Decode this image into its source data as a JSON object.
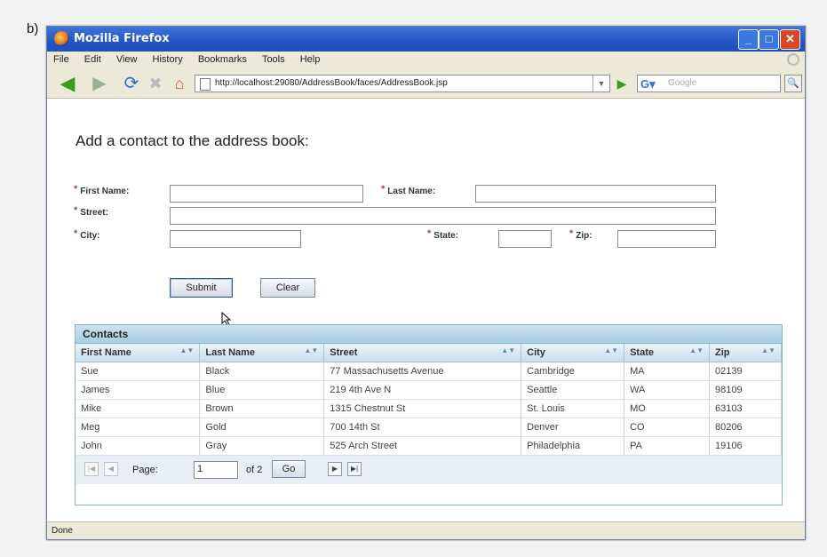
{
  "figure_label": "b)",
  "window": {
    "title": "Mozilla Firefox"
  },
  "menu": [
    "File",
    "Edit",
    "View",
    "History",
    "Bookmarks",
    "Tools",
    "Help"
  ],
  "address": {
    "url": "http://localhost:29080/AddressBook/faces/AddressBook.jsp"
  },
  "search": {
    "placeholder": "Google"
  },
  "page": {
    "heading": "Add a contact to the address book:",
    "required_mark": "*",
    "labels": {
      "first_name": "First Name:",
      "last_name": "Last Name:",
      "street": "Street:",
      "city": "City:",
      "state": "State:",
      "zip": "Zip:"
    },
    "buttons": {
      "submit": "Submit",
      "clear": "Clear"
    }
  },
  "table": {
    "caption": "Contacts",
    "columns": [
      "First Name",
      "Last Name",
      "Street",
      "City",
      "State",
      "Zip"
    ],
    "rows": [
      [
        "Sue",
        "Black",
        "77 Massachusetts Avenue",
        "Cambridge",
        "MA",
        "02139"
      ],
      [
        "James",
        "Blue",
        "219 4th Ave N",
        "Seattle",
        "WA",
        "98109"
      ],
      [
        "Mike",
        "Brown",
        "1315 Chestnut St",
        "St. Louis",
        "MO",
        "63103"
      ],
      [
        "Meg",
        "Gold",
        "700 14th St",
        "Denver",
        "CO",
        "80206"
      ],
      [
        "John",
        "Gray",
        "525 Arch Street",
        "Philadelphia",
        "PA",
        "19106"
      ]
    ],
    "pager": {
      "page_label": "Page:",
      "page_value": "1",
      "of_label": "of 2",
      "go": "Go"
    }
  },
  "status": "Done"
}
